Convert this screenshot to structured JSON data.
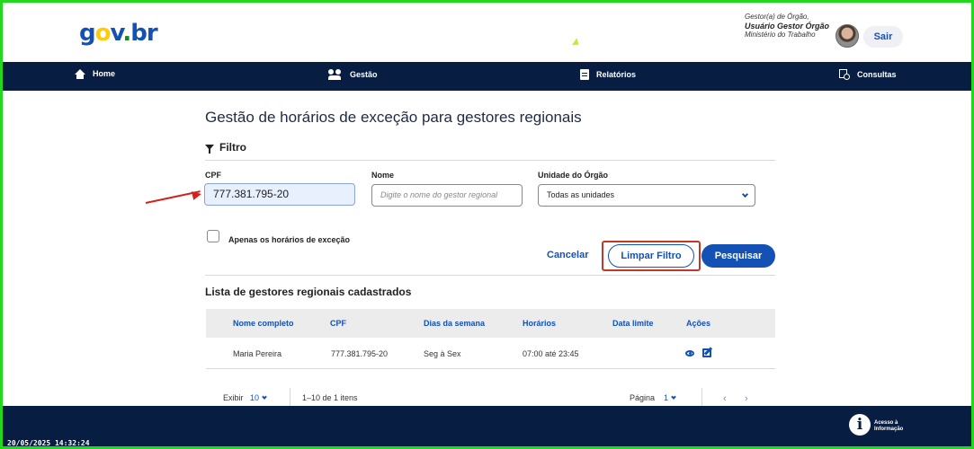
{
  "header": {
    "logo": {
      "g": "g",
      "o": "o",
      "v": "v",
      "dot": ".",
      "br": "br"
    },
    "user": {
      "role": "Gestor(a) de Órgão,",
      "name": "Usuário Gestor Órgão",
      "org": "Ministério do Trabalho"
    },
    "logout_label": "Sair"
  },
  "nav": [
    {
      "label": "Home",
      "icon": "home-icon"
    },
    {
      "label": "Gestão",
      "icon": "users-icon"
    },
    {
      "label": "Relatórios",
      "icon": "document-icon"
    },
    {
      "label": "Consultas",
      "icon": "search-document-icon"
    }
  ],
  "main": {
    "title": "Gestão de horários de exceção para gestores regionais",
    "filter_title": "Filtro",
    "fields": {
      "cpf_label": "CPF",
      "cpf_value": "777.381.795-20",
      "nome_label": "Nome",
      "nome_placeholder": "Digite o nome do gestor regional",
      "unidade_label": "Unidade do Órgão",
      "unidade_value": "Todas as unidades"
    },
    "checkbox_label": "Apenas os horários de exceção",
    "buttons": {
      "cancel": "Cancelar",
      "clear": "Limpar Filtro",
      "search": "Pesquisar"
    },
    "list_title": "Lista de gestores regionais cadastrados",
    "table": {
      "headers": [
        "Nome completo",
        "CPF",
        "Dias da semana",
        "Horários",
        "Data limite",
        "Ações"
      ],
      "rows": [
        {
          "nome": "Maria Pereira",
          "cpf": "777.381.795-20",
          "dias": "Seg à Sex",
          "horarios": "07:00 até 23:45",
          "data_limite": ""
        }
      ]
    },
    "pagination": {
      "show_label": "Exibir",
      "per_page": "10",
      "range": "1–10 de 1 itens",
      "page_label": "Página",
      "page": "1",
      "prev": "‹",
      "next": "›"
    }
  },
  "footer": {
    "datetime": "20/05/2025 14:32:24",
    "info_icon": "i",
    "info_text_1": "Acesso à",
    "info_text_2": "Informação"
  },
  "colors": {
    "primary": "#1351b4",
    "navy": "#071d41",
    "highlight": "#c0392b",
    "frame": "#22d81e"
  }
}
